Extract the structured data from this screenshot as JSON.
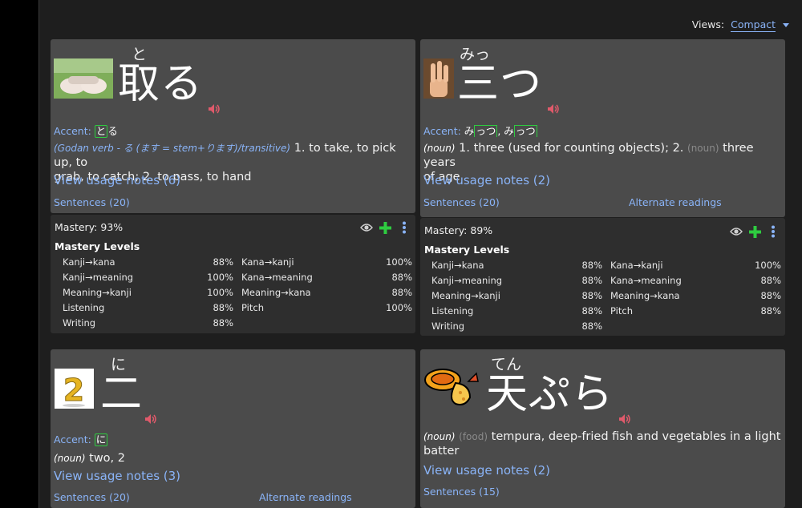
{
  "views": {
    "label": "Views:",
    "selected": "Compact"
  },
  "cards": [
    {
      "furigana": "と",
      "word": "取る",
      "image_icon": "hands-photo-icon",
      "accent_label": "Accent:",
      "accent_a": "と",
      "accent_b": "る",
      "grammar": "(Godan verb - る (ます = stem+ります)/transitive)",
      "definition_1": " 1. to take, to pick up, to",
      "definition_2": "grab, to catch; 2. to pass, to hand",
      "usage_notes": "View usage notes (6)",
      "sentences": "Sentences (20)"
    },
    {
      "furigana": "みっ",
      "word": "三つ",
      "image_icon": "three-fingers-photo-icon",
      "accent_label": "Accent:",
      "accent_a": "み",
      "accent_b": "っつ",
      "accent_sep": ", み",
      "accent_c": "っつ",
      "pos": "(noun)",
      "definition_1": " 1. three (used for counting objects); 2.",
      "tag": "(noun)",
      "definition_2": " three years",
      "definition_3": "of age",
      "usage_notes": "View usage notes (2)",
      "sentences": "Sentences (20)",
      "alternate": "Alternate readings"
    },
    {
      "furigana": "に",
      "word": "二",
      "image_icon": "number-two-icon",
      "accent_label": "Accent:",
      "accent_a": "に",
      "pos": "(noun)",
      "definition_1": " two, 2",
      "usage_notes": "View usage notes (3)",
      "sentences": "Sentences (20)",
      "alternate": "Alternate readings"
    },
    {
      "furigana": "てん",
      "word": "天ぷら",
      "image_icon": "tempura-icon",
      "pos": "(noun)",
      "tag": "(food)",
      "definition_1": " tempura, deep-fried fish and vegetables in a light",
      "definition_2": "batter",
      "usage_notes": "View usage notes (2)",
      "sentences": "Sentences (15)"
    }
  ],
  "mastery": [
    {
      "label": "Mastery: 93%",
      "levels_title": "Mastery Levels",
      "left": [
        {
          "name": "Kanji→kana",
          "value": "88%"
        },
        {
          "name": "Kanji→meaning",
          "value": "100%"
        },
        {
          "name": "Meaning→kanji",
          "value": "100%"
        },
        {
          "name": "Listening",
          "value": "88%"
        },
        {
          "name": "Writing",
          "value": "88%"
        }
      ],
      "right": [
        {
          "name": "Kana→kanji",
          "value": "100%"
        },
        {
          "name": "Kana→meaning",
          "value": "88%"
        },
        {
          "name": "Meaning→kana",
          "value": "88%"
        },
        {
          "name": "Pitch",
          "value": "100%"
        }
      ]
    },
    {
      "label": "Mastery: 89%",
      "levels_title": "Mastery Levels",
      "left": [
        {
          "name": "Kanji→kana",
          "value": "88%"
        },
        {
          "name": "Kanji→meaning",
          "value": "88%"
        },
        {
          "name": "Meaning→kanji",
          "value": "88%"
        },
        {
          "name": "Listening",
          "value": "88%"
        },
        {
          "name": "Writing",
          "value": "88%"
        }
      ],
      "right": [
        {
          "name": "Kana→kanji",
          "value": "100%"
        },
        {
          "name": "Kana→meaning",
          "value": "88%"
        },
        {
          "name": "Meaning→kana",
          "value": "88%"
        },
        {
          "name": "Pitch",
          "value": "88%"
        }
      ]
    }
  ],
  "colors": {
    "link": "#8ab4f8",
    "accent_box": "#2ecc40",
    "speaker": "#e05a6b",
    "plus": "#2ecc40"
  }
}
